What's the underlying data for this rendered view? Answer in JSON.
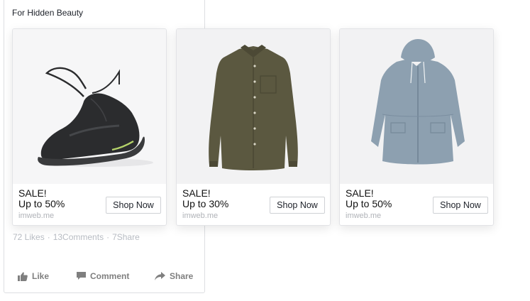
{
  "post": {
    "caption": "For Hidden Beauty",
    "engagement": {
      "likes": "72 Likes",
      "comments": "13Comments",
      "shares": "7Share",
      "separator": "·"
    },
    "actions": {
      "like": "Like",
      "comment": "Comment",
      "share": "Share"
    }
  },
  "carousel": {
    "cards": [
      {
        "line1": "SALE!",
        "line2": "Up to 50%",
        "domain": "imweb.me",
        "button": "Shop Now",
        "image": "sneaker"
      },
      {
        "line1": "SALE!",
        "line2": "Up to 30%",
        "domain": "imweb.me",
        "button": "Shop Now",
        "image": "shirt"
      },
      {
        "line1": "SALE!",
        "line2": "Up to 50%",
        "domain": "imweb.me",
        "button": "Shop Now",
        "image": "raincoat"
      }
    ]
  },
  "icons": {
    "like": "thumbs-up-icon",
    "comment": "speech-bubble-icon",
    "share": "share-arrow-icon"
  },
  "colors": {
    "muted_text": "#b8bcc3",
    "action_text": "#7f7f7f",
    "border": "#dddfe2",
    "shirt": "#5b5840",
    "raincoat": "#8da0b0",
    "sneaker": "#2a2b2d"
  }
}
